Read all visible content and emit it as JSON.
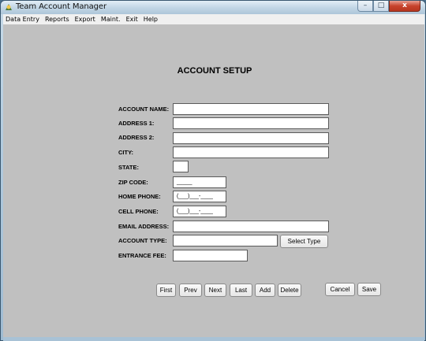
{
  "window": {
    "title": "Team Account Manager",
    "controls": {
      "minimize": "–",
      "maximize": "□",
      "close": "x"
    }
  },
  "menubar": {
    "items": [
      "Data Entry",
      "Reports",
      "Export",
      "Maint.",
      "Exit",
      "Help"
    ]
  },
  "form": {
    "heading": "ACCOUNT SETUP",
    "labels": {
      "account_name": "ACCOUNT NAME:",
      "address1": "ADDRESS 1:",
      "address2": "ADDRESS 2:",
      "city": "CITY:",
      "state": "STATE:",
      "zip": "ZIP CODE:",
      "home_phone": "HOME PHONE:",
      "cell_phone": "CELL PHONE:",
      "email": "EMAIL ADDRESS:",
      "account_type": "ACCOUNT TYPE:",
      "entrance_fee": "ENTRANCE FEE:"
    },
    "values": {
      "account_name": "",
      "address1": "",
      "address2": "",
      "city": "",
      "state": "",
      "zip": "_____",
      "home_phone": "(___)___-____",
      "cell_phone": "(___)___-____",
      "email": "",
      "account_type": "",
      "entrance_fee": ""
    },
    "select_type_button": "Select Type"
  },
  "nav_buttons": {
    "first": "First",
    "prev": "Prev",
    "next": "Next",
    "last": "Last",
    "add": "Add",
    "delete": "Delete",
    "cancel": "Cancel",
    "save": "Save"
  }
}
